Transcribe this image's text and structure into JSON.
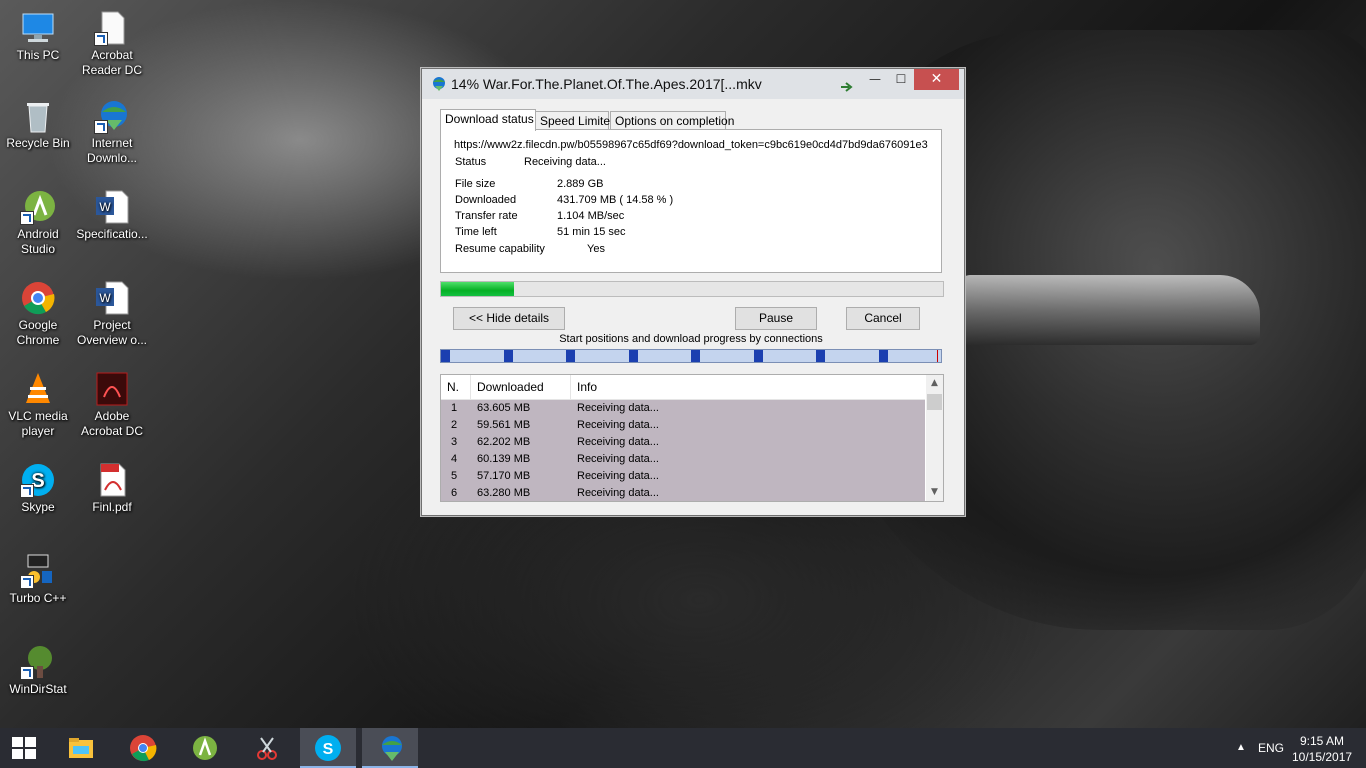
{
  "desktop": {
    "icons": [
      {
        "label": "This PC"
      },
      {
        "label": "Acrobat Reader DC"
      },
      {
        "label": "Recycle Bin"
      },
      {
        "label": "Internet Downlo..."
      },
      {
        "label": "Android Studio"
      },
      {
        "label": "Specificatio..."
      },
      {
        "label": "Google Chrome"
      },
      {
        "label": "Project Overview o..."
      },
      {
        "label": "VLC media player"
      },
      {
        "label": "Adobe Acrobat DC"
      },
      {
        "label": "Skype"
      },
      {
        "label": "Finl.pdf"
      },
      {
        "label": "Turbo C++"
      },
      {
        "label": "WinDirStat"
      }
    ]
  },
  "window": {
    "title": "14% War.For.The.Planet.Of.The.Apes.2017[...mkv",
    "close_glyph": "✕",
    "min_glyph": "—",
    "max_glyph": "☐",
    "tabs": [
      {
        "label": "Download status"
      },
      {
        "label": "Speed Limiter"
      },
      {
        "label": "Options on completion"
      }
    ],
    "url": "https://www2z.filecdn.pw/b05598967c65df69?download_token=c9bc619e0cd4d7bd9da676091e3",
    "status": {
      "label": "Status",
      "value": "Receiving data..."
    },
    "details": [
      {
        "label": "File size",
        "value": "2.889  GB"
      },
      {
        "label": "Downloaded",
        "value": "431.709  MB  ( 14.58 % )"
      },
      {
        "label": "Transfer rate",
        "value": "1.104  MB/sec"
      },
      {
        "label": "Time left",
        "value": "51 min 15 sec"
      },
      {
        "label": "Resume capability",
        "value": "Yes"
      }
    ],
    "progress_fraction": 0.1458,
    "buttons": {
      "hide_details": "<< Hide details",
      "pause": "Pause",
      "cancel": "Cancel"
    },
    "connections_label": "Start positions and download progress by connections",
    "connection_positions": [
      0.0,
      0.125,
      0.25,
      0.375,
      0.5,
      0.625,
      0.75,
      0.875
    ],
    "table": {
      "headers": [
        "N.",
        "Downloaded",
        "Info"
      ],
      "rows": [
        {
          "n": "1",
          "downloaded": "63.605  MB",
          "info": "Receiving data..."
        },
        {
          "n": "2",
          "downloaded": "59.561  MB",
          "info": "Receiving data..."
        },
        {
          "n": "3",
          "downloaded": "62.202  MB",
          "info": "Receiving data..."
        },
        {
          "n": "4",
          "downloaded": "60.139  MB",
          "info": "Receiving data..."
        },
        {
          "n": "5",
          "downloaded": "57.170  MB",
          "info": "Receiving data..."
        },
        {
          "n": "6",
          "downloaded": "63.280  MB",
          "info": "Receiving data..."
        }
      ]
    }
  },
  "taskbar": {
    "tray": {
      "language": "ENG",
      "time": "9:15 AM",
      "date": "10/15/2017",
      "overflow_glyph": "▲"
    }
  },
  "colors": {
    "accent_green": "#06b025",
    "status_blue": "#0033cc",
    "close_red": "#c75050"
  }
}
